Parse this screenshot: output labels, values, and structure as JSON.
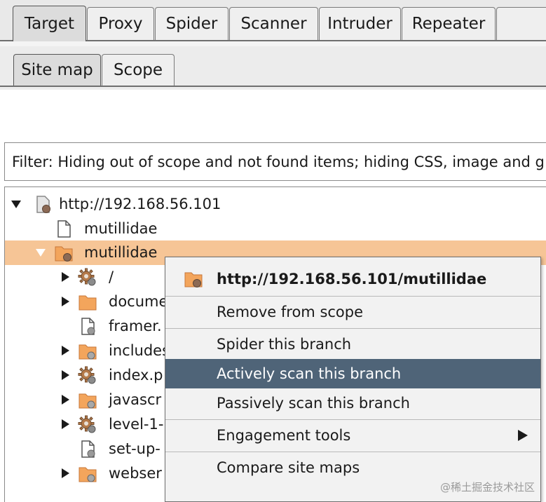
{
  "main_tabs": [
    "Target",
    "Proxy",
    "Spider",
    "Scanner",
    "Intruder",
    "Repeater"
  ],
  "main_tab_selected": "Target",
  "sub_tabs": [
    "Site map",
    "Scope"
  ],
  "sub_tab_selected": "Site map",
  "filter": {
    "text": "Filter: Hiding out of scope and not found items;  hiding CSS, image and g"
  },
  "tree": {
    "root": "http://192.168.56.101",
    "file_mutillidae": "mutillidae",
    "folder_mutillidae": "mutillidae",
    "children": [
      {
        "label": "/",
        "icon": "gear-icon"
      },
      {
        "label": "docume",
        "icon": "folder-icon"
      },
      {
        "label": "framer.",
        "icon": "file-gear-icon"
      },
      {
        "label": "includes",
        "icon": "folder-gear-icon"
      },
      {
        "label": "index.p",
        "icon": "gear-icon"
      },
      {
        "label": "javascr",
        "icon": "folder-gear-icon"
      },
      {
        "label": "level-1-",
        "icon": "gear-icon"
      },
      {
        "label": "set-up-",
        "icon": "file-gear-icon"
      },
      {
        "label": "webser",
        "icon": "folder-gear-icon"
      }
    ]
  },
  "context_menu": {
    "header": "http://192.168.56.101/mutillidae",
    "items": {
      "remove_scope": "Remove from scope",
      "spider": "Spider this branch",
      "active_scan": "Actively scan this branch",
      "passive_scan": "Passively scan this branch",
      "engagement": "Engagement tools",
      "compare": "Compare site maps"
    }
  },
  "watermark": "@稀土掘金技术社区",
  "colors": {
    "selected_row": "#f6c596",
    "menu_highlight": "#4f6478",
    "folder_orange": "#f3a55c"
  }
}
